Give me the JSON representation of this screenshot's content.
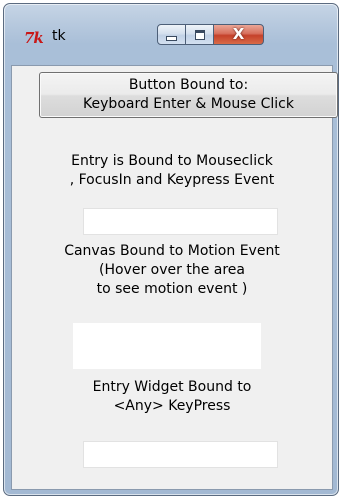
{
  "window": {
    "title": "tk",
    "app_icon": "tk-feather-icon",
    "close_glyph": "X"
  },
  "client": {
    "button": {
      "line1": "Button Bound to:",
      "line2": "Keyboard Enter & Mouse Click"
    },
    "entry_label": {
      "line1": "Entry is Bound to Mouseclick",
      "line2": ", FocusIn and Keypress Event"
    },
    "entry1_value": "",
    "canvas_label": {
      "line1": "Canvas Bound to Motion Event",
      "line2": "(Hover over the area",
      "line3": "to see motion event )"
    },
    "entry2_label": {
      "line1": "Entry Widget Bound to",
      "line2": "<Any> KeyPress"
    },
    "entry2_value": ""
  },
  "colors": {
    "frame": "#a9bfd8",
    "client_bg": "#f0f0f0",
    "close_button": "#c5412a",
    "tk_icon": "#c81818"
  }
}
